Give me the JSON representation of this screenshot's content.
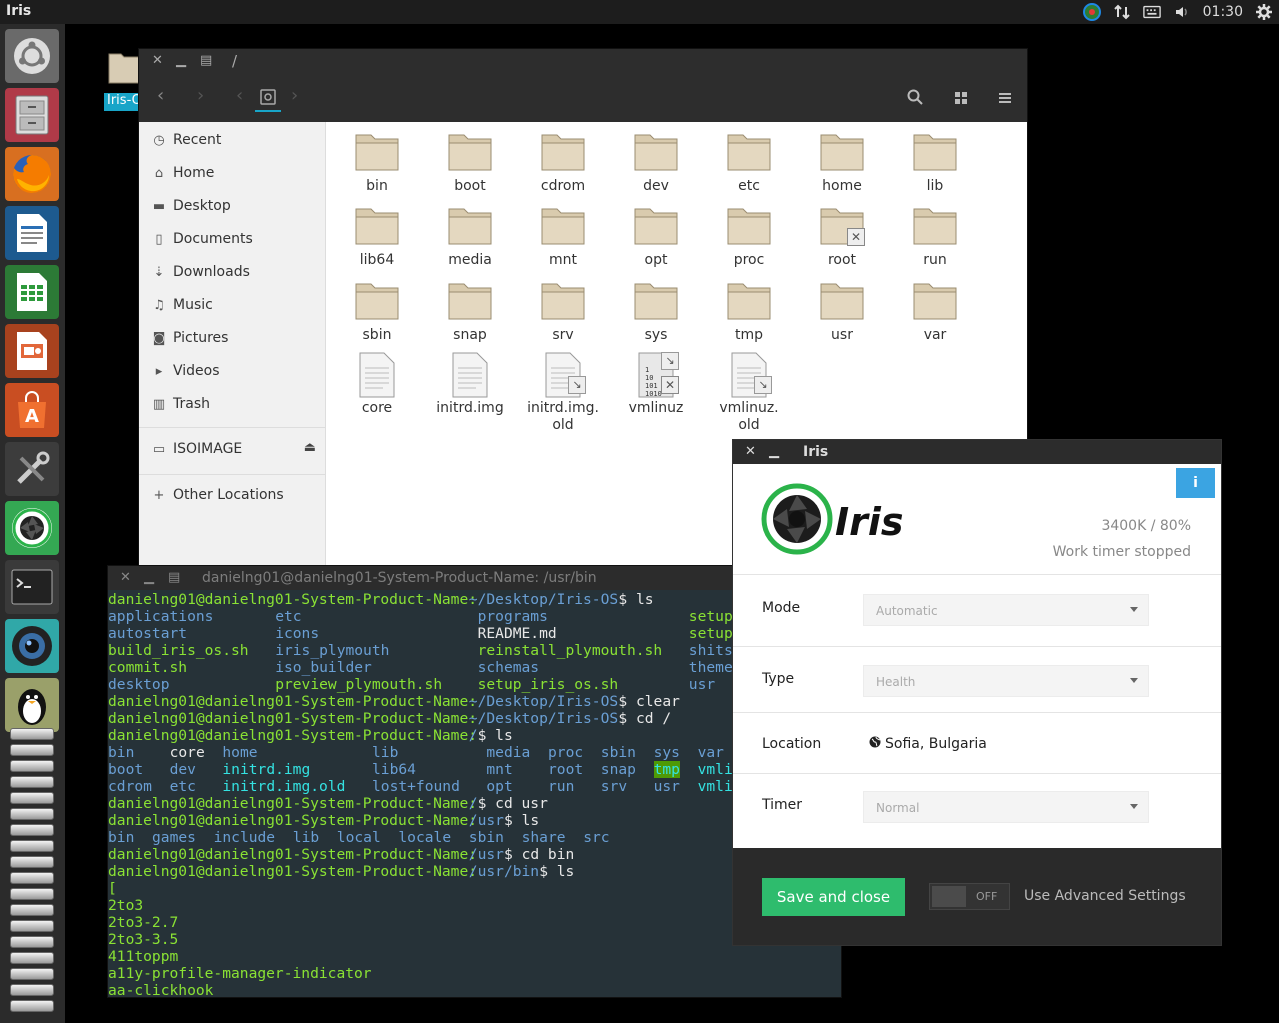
{
  "top_panel": {
    "app_name": "Iris",
    "clock": "01:30"
  },
  "desktop": {
    "folder_label": "Iris-O"
  },
  "file_manager": {
    "title": "/",
    "sidebar": [
      {
        "label": "Recent",
        "icon": "clock-icon"
      },
      {
        "label": "Home",
        "icon": "home-icon"
      },
      {
        "label": "Desktop",
        "icon": "folder-icon"
      },
      {
        "label": "Documents",
        "icon": "document-icon"
      },
      {
        "label": "Downloads",
        "icon": "download-icon"
      },
      {
        "label": "Music",
        "icon": "music-icon"
      },
      {
        "label": "Pictures",
        "icon": "camera-icon"
      },
      {
        "label": "Videos",
        "icon": "video-icon"
      },
      {
        "label": "Trash",
        "icon": "trash-icon"
      }
    ],
    "device": "ISOIMAGE",
    "other_locations": "Other Locations",
    "files": [
      {
        "name": "bin",
        "kind": "folder"
      },
      {
        "name": "boot",
        "kind": "folder"
      },
      {
        "name": "cdrom",
        "kind": "folder"
      },
      {
        "name": "dev",
        "kind": "folder"
      },
      {
        "name": "etc",
        "kind": "folder"
      },
      {
        "name": "home",
        "kind": "folder"
      },
      {
        "name": "lib",
        "kind": "folder"
      },
      {
        "name": "lib64",
        "kind": "folder"
      },
      {
        "name": "media",
        "kind": "folder"
      },
      {
        "name": "mnt",
        "kind": "folder"
      },
      {
        "name": "opt",
        "kind": "folder"
      },
      {
        "name": "proc",
        "kind": "folder"
      },
      {
        "name": "root",
        "kind": "folder-locked"
      },
      {
        "name": "run",
        "kind": "folder"
      },
      {
        "name": "sbin",
        "kind": "folder"
      },
      {
        "name": "snap",
        "kind": "folder"
      },
      {
        "name": "srv",
        "kind": "folder"
      },
      {
        "name": "sys",
        "kind": "folder"
      },
      {
        "name": "tmp",
        "kind": "folder"
      },
      {
        "name": "usr",
        "kind": "folder"
      },
      {
        "name": "var",
        "kind": "folder"
      },
      {
        "name": "core",
        "kind": "file"
      },
      {
        "name": "initrd.img",
        "kind": "file"
      },
      {
        "name": "initrd.img.\nold",
        "kind": "file-link"
      },
      {
        "name": "vmlinuz",
        "kind": "binary-link"
      },
      {
        "name": "vmlinuz.\nold",
        "kind": "file-link"
      }
    ]
  },
  "terminal": {
    "title": "danielng01@danielng01-System-Product-Name: /usr/bin",
    "lines": [
      [
        {
          "t": "danielng01@danielng01-System-Product-Name:",
          "c": "g",
          "col": 0
        },
        {
          "t": "~/Desktop/Iris-OS",
          "c": "b",
          "col": 41
        },
        {
          "t": "$ ls",
          "c": "w",
          "col": 58
        }
      ],
      [
        {
          "t": "applications",
          "c": "b",
          "col": 0
        },
        {
          "t": "etc",
          "c": "b",
          "col": 19
        },
        {
          "t": "programs",
          "c": "b",
          "col": 42
        },
        {
          "t": "setup.sh",
          "c": "g",
          "col": 66
        }
      ],
      [
        {
          "t": "autostart",
          "c": "b",
          "col": 0
        },
        {
          "t": "icons",
          "c": "b",
          "col": 19
        },
        {
          "t": "README.md",
          "c": "w",
          "col": 42
        },
        {
          "t": "setup_sc",
          "c": "g",
          "col": 66
        }
      ],
      [
        {
          "t": "build_iris_os.sh",
          "c": "g",
          "col": 0
        },
        {
          "t": "iris_plymouth",
          "c": "b",
          "col": 19
        },
        {
          "t": "reinstall_plymouth.sh",
          "c": "g",
          "col": 42
        },
        {
          "t": "shits",
          "c": "b",
          "col": 66
        }
      ],
      [
        {
          "t": "commit.sh",
          "c": "g",
          "col": 0
        },
        {
          "t": "iso_builder",
          "c": "b",
          "col": 19
        },
        {
          "t": "schemas",
          "c": "b",
          "col": 42
        },
        {
          "t": "themes",
          "c": "b",
          "col": 66
        }
      ],
      [
        {
          "t": "desktop",
          "c": "b",
          "col": 0
        },
        {
          "t": "preview_plymouth.sh",
          "c": "g",
          "col": 19
        },
        {
          "t": "setup_iris_os.sh",
          "c": "g",
          "col": 42
        },
        {
          "t": "usr",
          "c": "b",
          "col": 66
        }
      ],
      [
        {
          "t": "danielng01@danielng01-System-Product-Name:",
          "c": "g",
          "col": 0
        },
        {
          "t": "~/Desktop/Iris-OS",
          "c": "b",
          "col": 41
        },
        {
          "t": "$ clear",
          "c": "w",
          "col": 58
        }
      ],
      [
        {
          "t": "danielng01@danielng01-System-Product-Name:",
          "c": "g",
          "col": 0
        },
        {
          "t": "~/Desktop/Iris-OS",
          "c": "b",
          "col": 41
        },
        {
          "t": "$ cd /",
          "c": "w",
          "col": 58
        }
      ],
      [
        {
          "t": "danielng01@danielng01-System-Product-Name:",
          "c": "g",
          "col": 0
        },
        {
          "t": "/",
          "c": "b",
          "col": 41
        },
        {
          "t": "$ ls",
          "c": "w",
          "col": 42
        }
      ],
      [
        {
          "t": "bin",
          "c": "b",
          "col": 0
        },
        {
          "t": "core",
          "c": "w",
          "col": 7
        },
        {
          "t": "home",
          "c": "b",
          "col": 13
        },
        {
          "t": "lib",
          "c": "b",
          "col": 30
        },
        {
          "t": "media",
          "c": "b",
          "col": 43
        },
        {
          "t": "proc",
          "c": "b",
          "col": 50
        },
        {
          "t": "sbin",
          "c": "b",
          "col": 56
        },
        {
          "t": "sys",
          "c": "b",
          "col": 62
        },
        {
          "t": "var",
          "c": "b",
          "col": 67
        }
      ],
      [
        {
          "t": "boot",
          "c": "b",
          "col": 0
        },
        {
          "t": "dev",
          "c": "b",
          "col": 7
        },
        {
          "t": "initrd.img",
          "c": "c",
          "col": 13
        },
        {
          "t": "lib64",
          "c": "b",
          "col": 30
        },
        {
          "t": "mnt",
          "c": "b",
          "col": 43
        },
        {
          "t": "root",
          "c": "b",
          "col": 50
        },
        {
          "t": "snap",
          "c": "b",
          "col": 56
        },
        {
          "t": "tmp",
          "c": "hl",
          "col": 62
        },
        {
          "t": "vmlinuz",
          "c": "c",
          "col": 67
        }
      ],
      [
        {
          "t": "cdrom",
          "c": "b",
          "col": 0
        },
        {
          "t": "etc",
          "c": "b",
          "col": 7
        },
        {
          "t": "initrd.img.old",
          "c": "c",
          "col": 13
        },
        {
          "t": "lost+found",
          "c": "b",
          "col": 30
        },
        {
          "t": "opt",
          "c": "b",
          "col": 43
        },
        {
          "t": "run",
          "c": "b",
          "col": 50
        },
        {
          "t": "srv",
          "c": "b",
          "col": 56
        },
        {
          "t": "usr",
          "c": "b",
          "col": 62
        },
        {
          "t": "vmlinuz.old",
          "c": "c",
          "col": 67
        }
      ],
      [
        {
          "t": "danielng01@danielng01-System-Product-Name:",
          "c": "g",
          "col": 0
        },
        {
          "t": "/",
          "c": "b",
          "col": 41
        },
        {
          "t": "$ cd usr",
          "c": "w",
          "col": 42
        }
      ],
      [
        {
          "t": "danielng01@danielng01-System-Product-Name:",
          "c": "g",
          "col": 0
        },
        {
          "t": "/usr",
          "c": "b",
          "col": 41
        },
        {
          "t": "$ ls",
          "c": "w",
          "col": 45
        }
      ],
      [
        {
          "t": "bin",
          "c": "b",
          "col": 0
        },
        {
          "t": "games",
          "c": "b",
          "col": 5
        },
        {
          "t": "include",
          "c": "b",
          "col": 12
        },
        {
          "t": "lib",
          "c": "b",
          "col": 21
        },
        {
          "t": "local",
          "c": "b",
          "col": 26
        },
        {
          "t": "locale",
          "c": "b",
          "col": 33
        },
        {
          "t": "sbin",
          "c": "b",
          "col": 41
        },
        {
          "t": "share",
          "c": "b",
          "col": 47
        },
        {
          "t": "src",
          "c": "b",
          "col": 54
        }
      ],
      [
        {
          "t": "danielng01@danielng01-System-Product-Name:",
          "c": "g",
          "col": 0
        },
        {
          "t": "/usr",
          "c": "b",
          "col": 41
        },
        {
          "t": "$ cd bin",
          "c": "w",
          "col": 45
        }
      ],
      [
        {
          "t": "danielng01@danielng01-System-Product-Name:",
          "c": "g",
          "col": 0
        },
        {
          "t": "/usr/bin",
          "c": "b",
          "col": 41
        },
        {
          "t": "$ ls",
          "c": "w",
          "col": 49
        }
      ],
      [
        {
          "t": "[",
          "c": "g",
          "col": 0
        }
      ],
      [
        {
          "t": "2to3",
          "c": "g",
          "col": 0
        }
      ],
      [
        {
          "t": "2to3-2.7",
          "c": "g",
          "col": 0
        }
      ],
      [
        {
          "t": "2to3-3.5",
          "c": "g",
          "col": 0
        }
      ],
      [
        {
          "t": "411toppm",
          "c": "g",
          "col": 0
        }
      ],
      [
        {
          "t": "a11y-profile-manager-indicator",
          "c": "g",
          "col": 0
        }
      ],
      [
        {
          "t": "aa-clickhook",
          "c": "g",
          "col": 0
        }
      ]
    ]
  },
  "iris": {
    "title": "Iris",
    "info_label": "i",
    "brand": "Iris",
    "stat": "3400K / 80%",
    "status": "Work timer stopped",
    "mode_label": "Mode",
    "mode_value": "Automatic",
    "type_label": "Type",
    "type_value": "Health",
    "location_label": "Location",
    "location_value": "Sofia, Bulgaria",
    "timer_label": "Timer",
    "timer_value": "Normal",
    "save_label": "Save and close",
    "toggle_state": "OFF",
    "advanced_label": "Use Advanced Settings",
    "accent": "#2ebc6d",
    "info_color": "#3ba4e2"
  }
}
